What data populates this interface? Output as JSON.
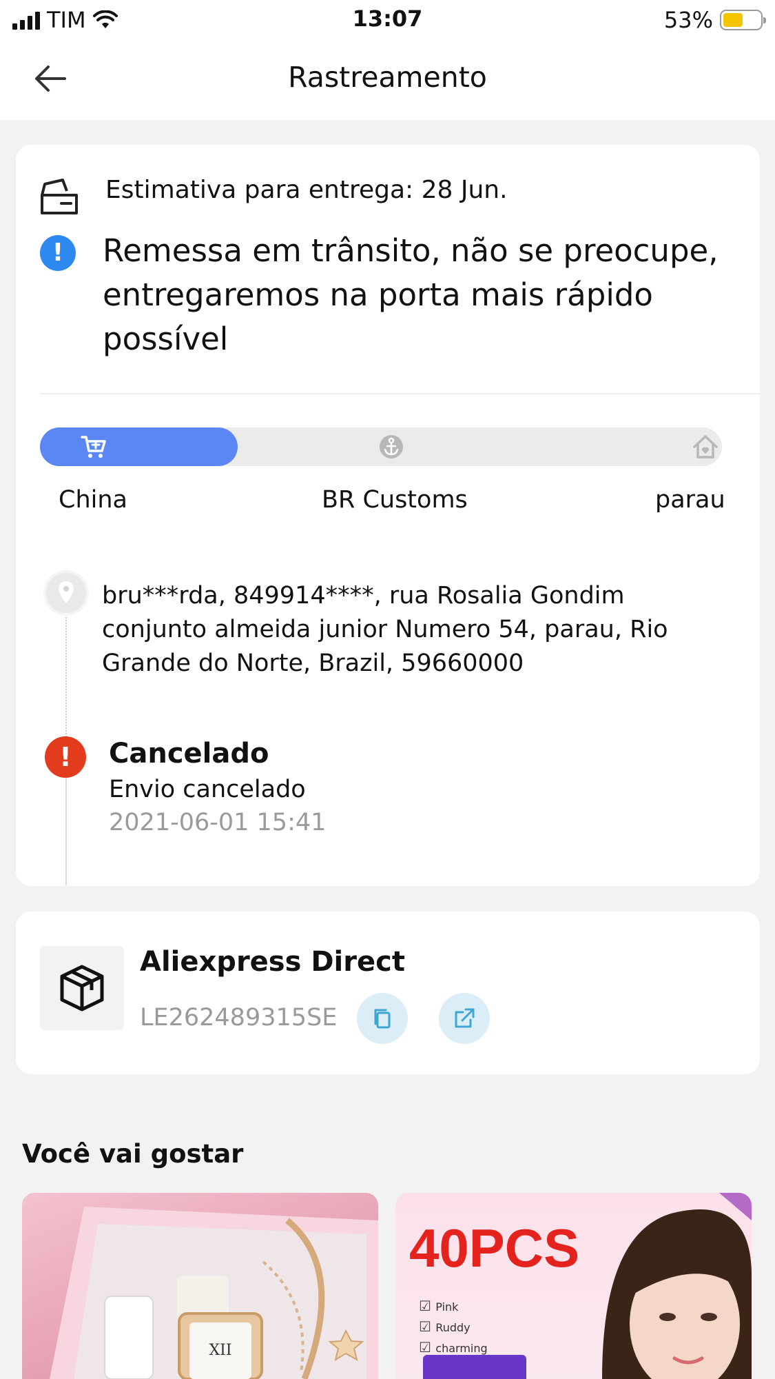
{
  "status_bar": {
    "carrier": "TIM",
    "time": "13:07",
    "battery": "53%",
    "battery_level": 0.53
  },
  "header": {
    "title": "Rastreamento",
    "back_icon": "arrow-left-icon"
  },
  "tracking": {
    "estimate": "Estimativa para entrega: 28 Jun.",
    "notice": "Remessa em trânsito, não se preocupe, entregaremos na porta mais rápido possível",
    "progress": {
      "fraction": 0.29,
      "stages": [
        "China",
        "BR Customs",
        "parau"
      ]
    },
    "address": "bru***rda,  849914****,  rua Rosalia Gondim conjunto almeida junior Numero 54,  parau,  Rio Grande do Norte,  Brazil,  59660000",
    "event": {
      "title": "Cancelado",
      "description": "Envio cancelado",
      "datetime": "2021-06-01 15:41"
    }
  },
  "carrier_card": {
    "name": "Aliexpress Direct",
    "tracking_number": "LE262489315SE"
  },
  "recommendations": {
    "title": "Você vai gostar",
    "products": [
      {
        "image": "watch-gift-set-image"
      },
      {
        "image": "facial-mask-promo-image",
        "promo_text": "40PCS",
        "options": [
          "Pink",
          "Ruddy",
          "charming"
        ]
      }
    ]
  },
  "colors": {
    "accent": "#5b87f5",
    "info": "#2d89ef",
    "error": "#e23b1e",
    "promo": "#e4231e"
  }
}
